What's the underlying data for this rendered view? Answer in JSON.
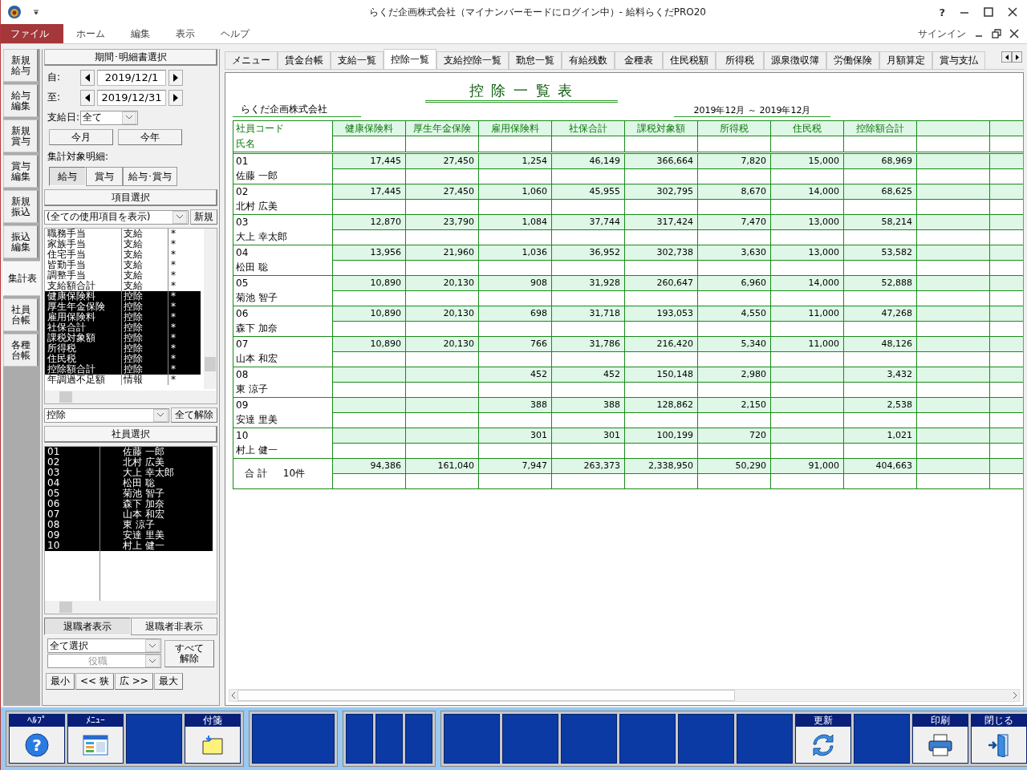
{
  "window": {
    "title": "らくだ企画株式会社（マイナンバーモードにログイン中）- 給料らくだPRO20",
    "help_glyph": "?"
  },
  "menu": [
    {
      "label": "ファイル",
      "selected": true
    },
    {
      "label": "ホーム",
      "selected": false
    },
    {
      "label": "編集",
      "selected": false
    },
    {
      "label": "表示",
      "selected": false
    },
    {
      "label": "ヘルプ",
      "selected": false
    }
  ],
  "sign_in": "サインイン",
  "side_tabs": [
    {
      "label": "新規給与",
      "selected": false
    },
    {
      "label": "給与編集",
      "selected": false
    },
    {
      "label": "新規賞与",
      "selected": false
    },
    {
      "label": "賞与編集",
      "selected": false
    },
    {
      "label": "新規振込",
      "selected": false
    },
    {
      "label": "振込編集",
      "selected": false
    },
    {
      "label": "集計表",
      "selected": true
    },
    {
      "label": "社員台帳",
      "selected": false
    },
    {
      "label": "各種台帳",
      "selected": false
    }
  ],
  "period": {
    "header": "期間･明細書選択",
    "from_label": "自:",
    "from": "2019/12/1",
    "to_label": "至:",
    "to": "2019/12/31",
    "payday_label": "支給日:",
    "payday": "全て",
    "buttons": [
      "今月",
      "今年"
    ],
    "target_label": "集計対象明細:",
    "targets": [
      {
        "label": "給与",
        "selected": true
      },
      {
        "label": "賞与",
        "selected": false
      },
      {
        "label": "給与･賞与",
        "selected": false
      }
    ]
  },
  "items": {
    "header": "項目選択",
    "filter": "(全ての使用項目を表示)",
    "new_button": "新規",
    "rows": [
      {
        "name": "職務手当",
        "type": "支給",
        "mark": "*",
        "selected": false
      },
      {
        "name": "家族手当",
        "type": "支給",
        "mark": "*",
        "selected": false
      },
      {
        "name": "住宅手当",
        "type": "支給",
        "mark": "*",
        "selected": false
      },
      {
        "name": "皆勤手当",
        "type": "支給",
        "mark": "*",
        "selected": false
      },
      {
        "name": "調整手当",
        "type": "支給",
        "mark": "*",
        "selected": false
      },
      {
        "name": "支給額合計",
        "type": "支給",
        "mark": "*",
        "selected": false
      },
      {
        "name": "健康保険料",
        "type": "控除",
        "mark": "*",
        "selected": true
      },
      {
        "name": "厚生年金保険",
        "type": "控除",
        "mark": "*",
        "selected": true
      },
      {
        "name": "雇用保険料",
        "type": "控除",
        "mark": "*",
        "selected": true
      },
      {
        "name": "社保合計",
        "type": "控除",
        "mark": "*",
        "selected": true
      },
      {
        "name": "課税対象額",
        "type": "控除",
        "mark": "*",
        "selected": true
      },
      {
        "name": "所得税",
        "type": "控除",
        "mark": "*",
        "selected": true
      },
      {
        "name": "住民税",
        "type": "控除",
        "mark": "*",
        "selected": true
      },
      {
        "name": "控除額合計",
        "type": "控除",
        "mark": "*",
        "selected": true
      },
      {
        "name": "年調過不足額",
        "type": "情報",
        "mark": "*",
        "selected": false
      }
    ],
    "category": "控除",
    "clear_button": "全て解除"
  },
  "employees": {
    "header": "社員選択",
    "rows": [
      {
        "code": "01",
        "name": "佐藤 一郎",
        "selected": true
      },
      {
        "code": "02",
        "name": "北村 広美",
        "selected": true
      },
      {
        "code": "03",
        "name": "大上 幸太郎",
        "selected": true
      },
      {
        "code": "04",
        "name": "松田 聡",
        "selected": true
      },
      {
        "code": "05",
        "name": "菊池 智子",
        "selected": true
      },
      {
        "code": "06",
        "name": "森下 加奈",
        "selected": true
      },
      {
        "code": "07",
        "name": "山本 和宏",
        "selected": true
      },
      {
        "code": "08",
        "name": "東 涼子",
        "selected": true
      },
      {
        "code": "09",
        "name": "安達 里美",
        "selected": true
      },
      {
        "code": "10",
        "name": "村上 健一",
        "selected": true
      }
    ],
    "retiree": [
      {
        "label": "退職者表示",
        "selected": true
      },
      {
        "label": "退職者非表示",
        "selected": false
      }
    ],
    "select_combo": "全て選択",
    "role_placeholder": "役職",
    "clear_all": "すべて解除",
    "width_buttons": [
      "最小",
      "<< 狭",
      "広 >>",
      "最大"
    ]
  },
  "tabs": [
    {
      "label": "メニュー",
      "selected": false
    },
    {
      "label": "賃金台帳",
      "selected": false
    },
    {
      "label": "支給一覧",
      "selected": false
    },
    {
      "label": "控除一覧",
      "selected": true
    },
    {
      "label": "支給控除一覧",
      "selected": false
    },
    {
      "label": "勤怠一覧",
      "selected": false
    },
    {
      "label": "有給残数",
      "selected": false
    },
    {
      "label": "金種表",
      "selected": false
    },
    {
      "label": "住民税額",
      "selected": false
    },
    {
      "label": "所得税",
      "selected": false
    },
    {
      "label": "源泉徴収簿",
      "selected": false
    },
    {
      "label": "労働保険",
      "selected": false
    },
    {
      "label": "月額算定",
      "selected": false
    },
    {
      "label": "賞与支払",
      "selected": false
    }
  ],
  "report": {
    "title": "控 除 一 覧 表",
    "company": "らくだ企画株式会社",
    "period": "2019年12月 ～ 2019年12月",
    "code_header": "社員コード",
    "name_header": "氏名",
    "columns": [
      "健康保険料",
      "厚生年金保険",
      "雇用保険料",
      "社保合計",
      "課税対象額",
      "所得税",
      "住民税",
      "控除額合計"
    ],
    "rows": [
      {
        "code": "01",
        "name": "佐藤 一郎",
        "health_insurance": "17,445",
        "pension_insurance": "27,450",
        "employment_insurance": "1,254",
        "social_insurance_total": "46,149",
        "taxable_amount": "366,664",
        "income_tax": "7,820",
        "resident_tax": "15,000",
        "deduction_total": "68,969"
      },
      {
        "code": "02",
        "name": "北村 広美",
        "health_insurance": "17,445",
        "pension_insurance": "27,450",
        "employment_insurance": "1,060",
        "social_insurance_total": "45,955",
        "taxable_amount": "302,795",
        "income_tax": "8,670",
        "resident_tax": "14,000",
        "deduction_total": "68,625"
      },
      {
        "code": "03",
        "name": "大上 幸太郎",
        "health_insurance": "12,870",
        "pension_insurance": "23,790",
        "employment_insurance": "1,084",
        "social_insurance_total": "37,744",
        "taxable_amount": "317,424",
        "income_tax": "7,470",
        "resident_tax": "13,000",
        "deduction_total": "58,214"
      },
      {
        "code": "04",
        "name": "松田 聡",
        "health_insurance": "13,956",
        "pension_insurance": "21,960",
        "employment_insurance": "1,036",
        "social_insurance_total": "36,952",
        "taxable_amount": "302,738",
        "income_tax": "3,630",
        "resident_tax": "13,000",
        "deduction_total": "53,582"
      },
      {
        "code": "05",
        "name": "菊池 智子",
        "health_insurance": "10,890",
        "pension_insurance": "20,130",
        "employment_insurance": "908",
        "social_insurance_total": "31,928",
        "taxable_amount": "260,647",
        "income_tax": "6,960",
        "resident_tax": "14,000",
        "deduction_total": "52,888"
      },
      {
        "code": "06",
        "name": "森下 加奈",
        "health_insurance": "10,890",
        "pension_insurance": "20,130",
        "employment_insurance": "698",
        "social_insurance_total": "31,718",
        "taxable_amount": "193,053",
        "income_tax": "4,550",
        "resident_tax": "11,000",
        "deduction_total": "47,268"
      },
      {
        "code": "07",
        "name": "山本 和宏",
        "health_insurance": "10,890",
        "pension_insurance": "20,130",
        "employment_insurance": "766",
        "social_insurance_total": "31,786",
        "taxable_amount": "216,420",
        "income_tax": "5,340",
        "resident_tax": "11,000",
        "deduction_total": "48,126"
      },
      {
        "code": "08",
        "name": "東 涼子",
        "employment_insurance": "452",
        "social_insurance_total": "452",
        "taxable_amount": "150,148",
        "income_tax": "2,980",
        "deduction_total": "3,432"
      },
      {
        "code": "09",
        "name": "安達 里美",
        "employment_insurance": "388",
        "social_insurance_total": "388",
        "taxable_amount": "128,862",
        "income_tax": "2,150",
        "deduction_total": "2,538"
      },
      {
        "code": "10",
        "name": "村上 健一",
        "employment_insurance": "301",
        "social_insurance_total": "301",
        "taxable_amount": "100,199",
        "income_tax": "720",
        "deduction_total": "1,021"
      }
    ],
    "total": {
      "label": "合 計",
      "count": "10件",
      "values": [
        "94,386",
        "161,040",
        "7,947",
        "263,373",
        "2,338,950",
        "50,290",
        "91,000",
        "404,663"
      ]
    }
  },
  "toolbar": [
    [
      {
        "kind": "help",
        "label": "ﾍﾙﾌﾟ",
        "glyph": "?"
      },
      {
        "kind": "menu",
        "label": "ﾒﾆｭｰ"
      },
      {
        "kind": "blank"
      },
      {
        "kind": "note",
        "label": "付箋"
      }
    ],
    [
      {
        "kind": "wide"
      }
    ],
    [
      {
        "kind": "narrow"
      },
      {
        "kind": "narrow"
      },
      {
        "kind": "narrow"
      }
    ],
    [
      {
        "kind": "blank"
      },
      {
        "kind": "blank"
      },
      {
        "kind": "blank"
      },
      {
        "kind": "blank"
      },
      {
        "kind": "blank"
      },
      {
        "kind": "blank"
      },
      {
        "kind": "refresh",
        "label": "更新"
      },
      {
        "kind": "blank"
      },
      {
        "kind": "print",
        "label": "印刷"
      },
      {
        "kind": "exit",
        "label": "閉じる"
      }
    ]
  ]
}
